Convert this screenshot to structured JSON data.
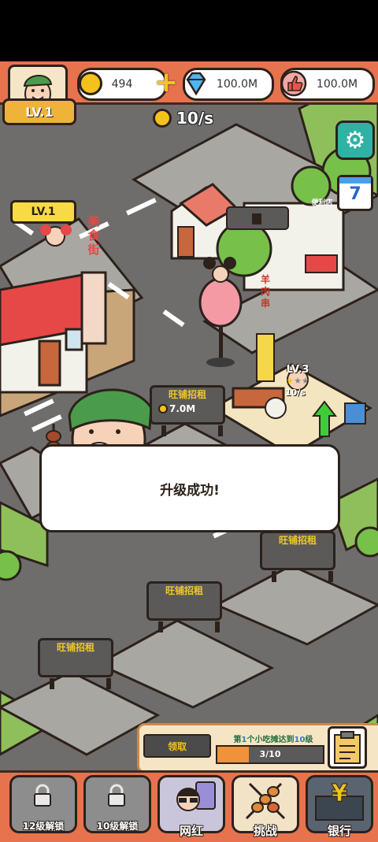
{
  "player": {
    "level": "LV.1"
  },
  "resources": {
    "coins": "494",
    "gems": "100.0M",
    "likes": "100.0M"
  },
  "income": {
    "rate": "10/s"
  },
  "calendar": {
    "day": "7"
  },
  "map": {
    "shop_left_level": "LV.1",
    "stall_level": "LV.3",
    "stall_rate": "10/s",
    "stall_stars": 1,
    "shop_sign_left": "美食街",
    "stall_sign": "羊肉串",
    "store_sign": "便利店",
    "vacant_signs": [
      {
        "label": "旺铺招租",
        "price": "7.0M"
      },
      {
        "label": "旺铺招租"
      },
      {
        "label": "旺铺招租"
      },
      {
        "label": "旺铺招租"
      }
    ]
  },
  "dialog": {
    "message": "升级成功!"
  },
  "quest": {
    "claim_label": "领取",
    "prefix": "第",
    "num": "1",
    "middle": "个小吃摊达到",
    "target": "10",
    "suffix": "级",
    "progress_text": "3/10",
    "progress": 0.3
  },
  "bottom_nav": [
    {
      "label": "12级解锁",
      "icon": "lock-icon"
    },
    {
      "label": "10级解锁",
      "icon": "lock-icon"
    },
    {
      "label": "网红",
      "icon": "influencer-icon"
    },
    {
      "label": "挑战",
      "icon": "skewer-icon"
    },
    {
      "label": "银行",
      "icon": "bank-icon"
    }
  ],
  "colors": {
    "accent": "#e6734e",
    "road": "#6f6d6c",
    "coin": "#f3c21d",
    "teal": "#2fb2a4"
  }
}
